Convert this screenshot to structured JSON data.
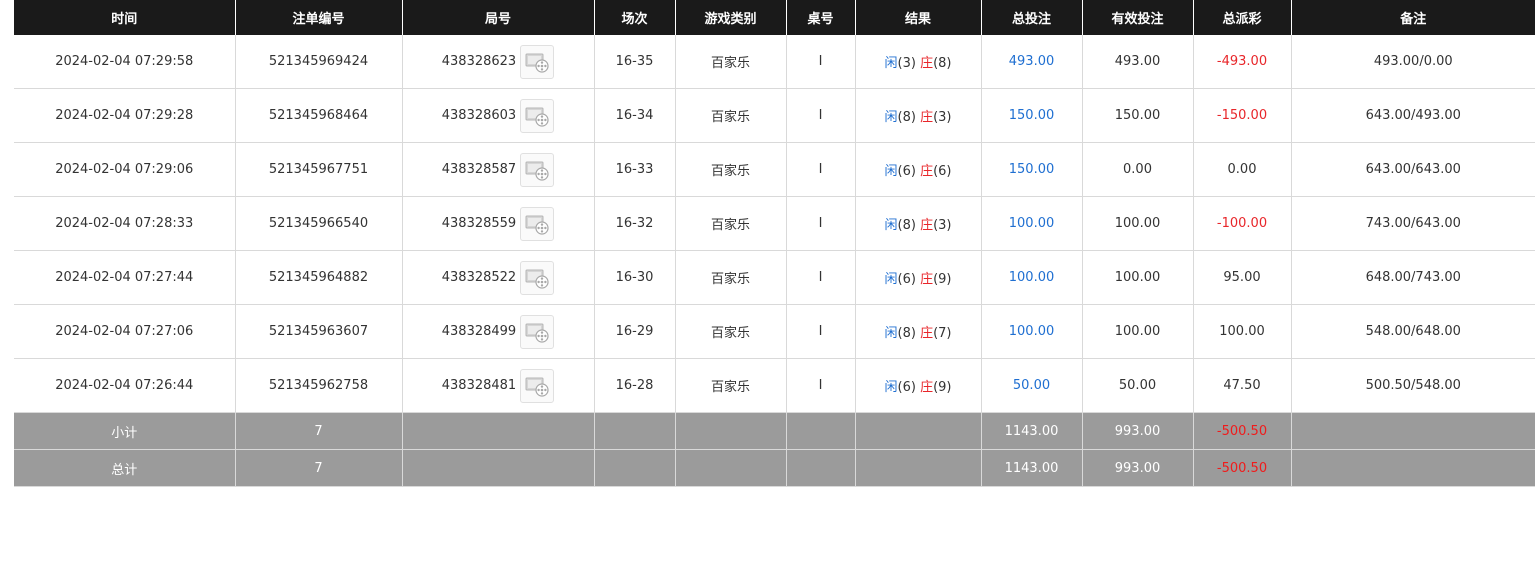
{
  "headers": [
    "时间",
    "注单编号",
    "局号",
    "场次",
    "游戏类别",
    "桌号",
    "结果",
    "总投注",
    "有效投注",
    "总派彩",
    "备注"
  ],
  "rows": [
    {
      "time": "2024-02-04 07:29:58",
      "bet_id": "521345969424",
      "round": "438328623",
      "session": "16-35",
      "game": "百家乐",
      "table": "I",
      "xian_label": "闲",
      "xian_val": "(3)",
      "zhuang_label": "庄",
      "zhuang_val": "(8)",
      "total_bet": "493.00",
      "valid_bet": "493.00",
      "payout": "-493.00",
      "payout_negative": true,
      "note": "493.00/0.00"
    },
    {
      "time": "2024-02-04 07:29:28",
      "bet_id": "521345968464",
      "round": "438328603",
      "session": "16-34",
      "game": "百家乐",
      "table": "I",
      "xian_label": "闲",
      "xian_val": "(8)",
      "zhuang_label": "庄",
      "zhuang_val": "(3)",
      "total_bet": "150.00",
      "valid_bet": "150.00",
      "payout": "-150.00",
      "payout_negative": true,
      "note": "643.00/493.00"
    },
    {
      "time": "2024-02-04 07:29:06",
      "bet_id": "521345967751",
      "round": "438328587",
      "session": "16-33",
      "game": "百家乐",
      "table": "I",
      "xian_label": "闲",
      "xian_val": "(6)",
      "zhuang_label": "庄",
      "zhuang_val": "(6)",
      "total_bet": "150.00",
      "valid_bet": "0.00",
      "payout": "0.00",
      "payout_negative": false,
      "note": "643.00/643.00"
    },
    {
      "time": "2024-02-04 07:28:33",
      "bet_id": "521345966540",
      "round": "438328559",
      "session": "16-32",
      "game": "百家乐",
      "table": "I",
      "xian_label": "闲",
      "xian_val": "(8)",
      "zhuang_label": "庄",
      "zhuang_val": "(3)",
      "total_bet": "100.00",
      "valid_bet": "100.00",
      "payout": "-100.00",
      "payout_negative": true,
      "note": "743.00/643.00"
    },
    {
      "time": "2024-02-04 07:27:44",
      "bet_id": "521345964882",
      "round": "438328522",
      "session": "16-30",
      "game": "百家乐",
      "table": "I",
      "xian_label": "闲",
      "xian_val": "(6)",
      "zhuang_label": "庄",
      "zhuang_val": "(9)",
      "total_bet": "100.00",
      "valid_bet": "100.00",
      "payout": "95.00",
      "payout_negative": false,
      "note": "648.00/743.00"
    },
    {
      "time": "2024-02-04 07:27:06",
      "bet_id": "521345963607",
      "round": "438328499",
      "session": "16-29",
      "game": "百家乐",
      "table": "I",
      "xian_label": "闲",
      "xian_val": "(8)",
      "zhuang_label": "庄",
      "zhuang_val": "(7)",
      "total_bet": "100.00",
      "valid_bet": "100.00",
      "payout": "100.00",
      "payout_negative": false,
      "note": "548.00/648.00"
    },
    {
      "time": "2024-02-04 07:26:44",
      "bet_id": "521345962758",
      "round": "438328481",
      "session": "16-28",
      "game": "百家乐",
      "table": "I",
      "xian_label": "闲",
      "xian_val": "(6)",
      "zhuang_label": "庄",
      "zhuang_val": "(9)",
      "total_bet": "50.00",
      "valid_bet": "50.00",
      "payout": "47.50",
      "payout_negative": false,
      "note": "500.50/548.00"
    }
  ],
  "subtotal": {
    "label": "小计",
    "count": "7",
    "total_bet": "1143.00",
    "valid_bet": "993.00",
    "payout": "-500.50"
  },
  "grandtotal": {
    "label": "总计",
    "count": "7",
    "total_bet": "1143.00",
    "valid_bet": "993.00",
    "payout": "-500.50"
  },
  "icons": {
    "replay": "replay-video-icon"
  },
  "colors": {
    "header_bg": "#1a1a1a",
    "summary_bg": "#9b9b9b",
    "blue": "#1f6fd1",
    "red": "#e8262a"
  }
}
